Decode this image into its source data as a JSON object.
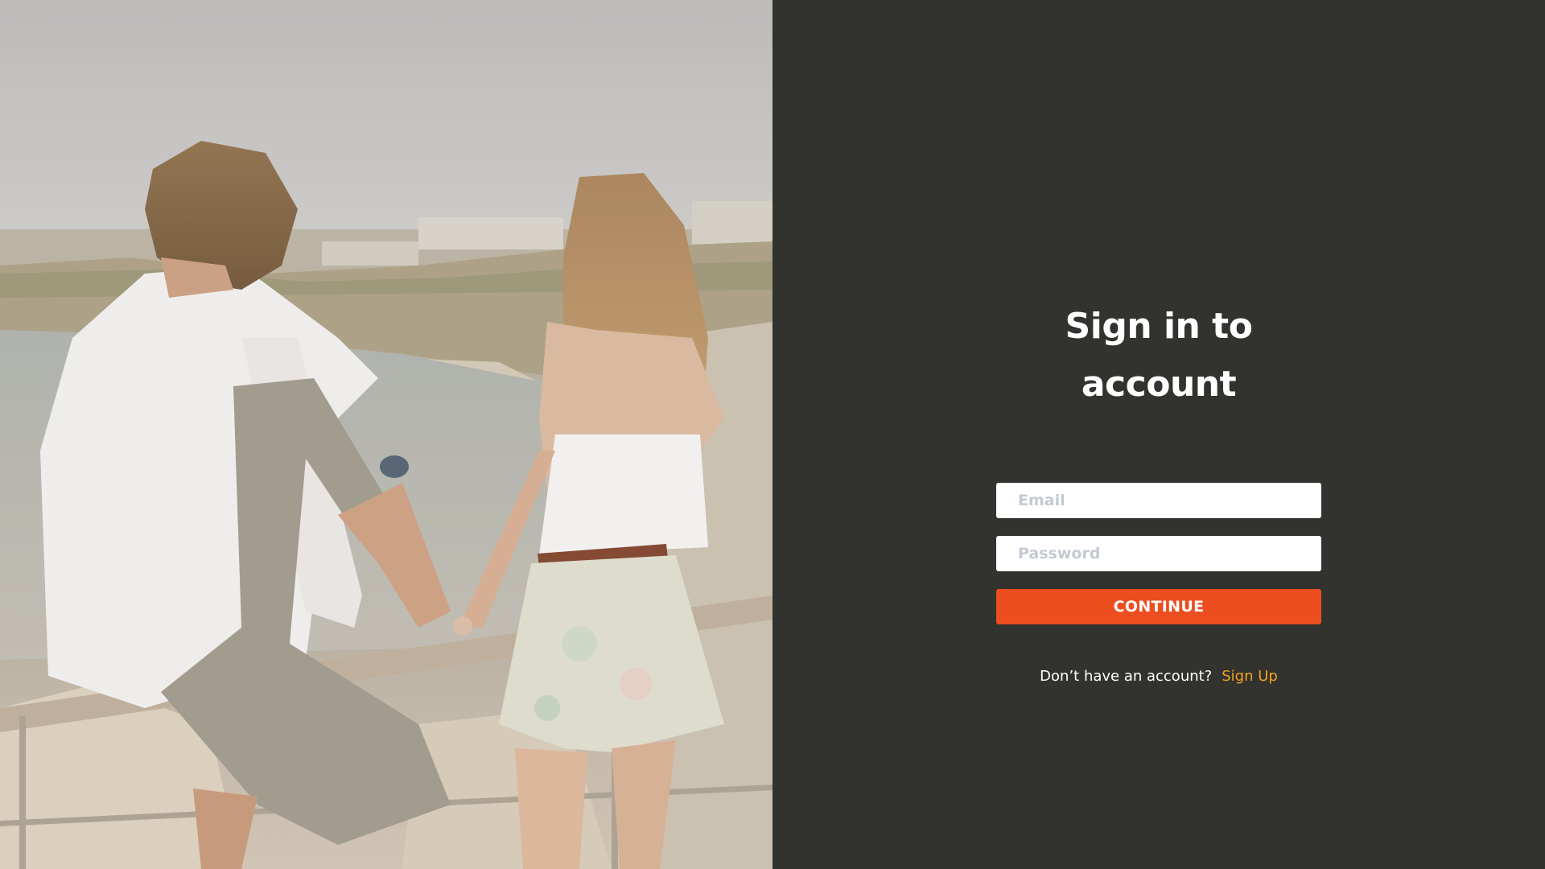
{
  "hero_image": {
    "description_icon": "couple-by-sea-photo"
  },
  "form": {
    "title": "Sign in to account",
    "email_placeholder": "Email",
    "password_placeholder": "Password",
    "submit_label": "CONTINUE",
    "signup_prompt": "Don’t have an account?",
    "signup_link_label": "Sign Up"
  },
  "colors": {
    "panel_background": "#32322e",
    "accent": "#ec4e20",
    "link": "#f0a41e",
    "input_background": "#ffffff",
    "placeholder": "#c3cad3"
  }
}
